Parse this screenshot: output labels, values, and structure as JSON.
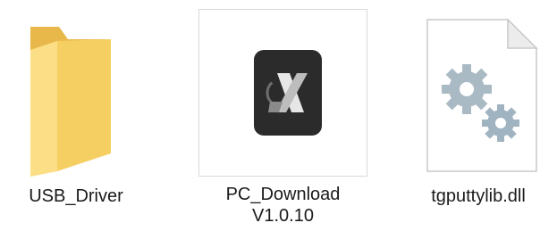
{
  "files": [
    {
      "name": "USB_Driver",
      "type": "folder",
      "icon": "folder-icon"
    },
    {
      "name": "PC_Download\nV1.0.10",
      "type": "application",
      "icon": "app-x-logo-icon",
      "selected": true
    },
    {
      "name": "tgputtylib.dll",
      "type": "dll",
      "icon": "dll-gears-icon"
    }
  ],
  "colors": {
    "folder_front": "#f8d774",
    "folder_back": "#e8b84a",
    "app_tile": "#2b2b2b",
    "selection_border": "#d9d9d9",
    "gear": "#9fb3c0"
  }
}
